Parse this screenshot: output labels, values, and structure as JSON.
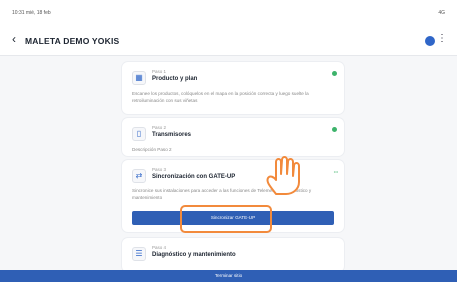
{
  "statusbar": {
    "left": "10:31 mié, 18 feb",
    "right": "4G"
  },
  "header": {
    "back_icon": "arrow-left-icon",
    "title": "MALETA DEMO YOKIS",
    "more_icon": "more-vertical-icon"
  },
  "steps": [
    {
      "step": "Paso 1",
      "name": "Producto y plan",
      "description": "Escanee los productos, colóquelos en el mapa en la posición correcta y luego suelte la retroiluminación con sus viñetas",
      "status": "done"
    },
    {
      "step": "Paso 2",
      "name": "Transmisores",
      "description": "Descripción Paso 2",
      "status": "done"
    },
    {
      "step": "Paso 3",
      "name": "Sincronización con GATE-UP",
      "description": "Sincronice sus instalaciones para acceder a las funciones de Telemetría y Diagnóstico y mantenimiento",
      "status_label": "•••",
      "button_label": "Sincronizar GATE-UP"
    },
    {
      "step": "Paso 4",
      "name": "Diagnóstico y mantenimiento"
    }
  ],
  "footer": {
    "button_label": "Terminar sitio"
  },
  "colors": {
    "accent": "#2f5fb5",
    "highlight": "#f28a3c",
    "done": "#3db36b"
  }
}
